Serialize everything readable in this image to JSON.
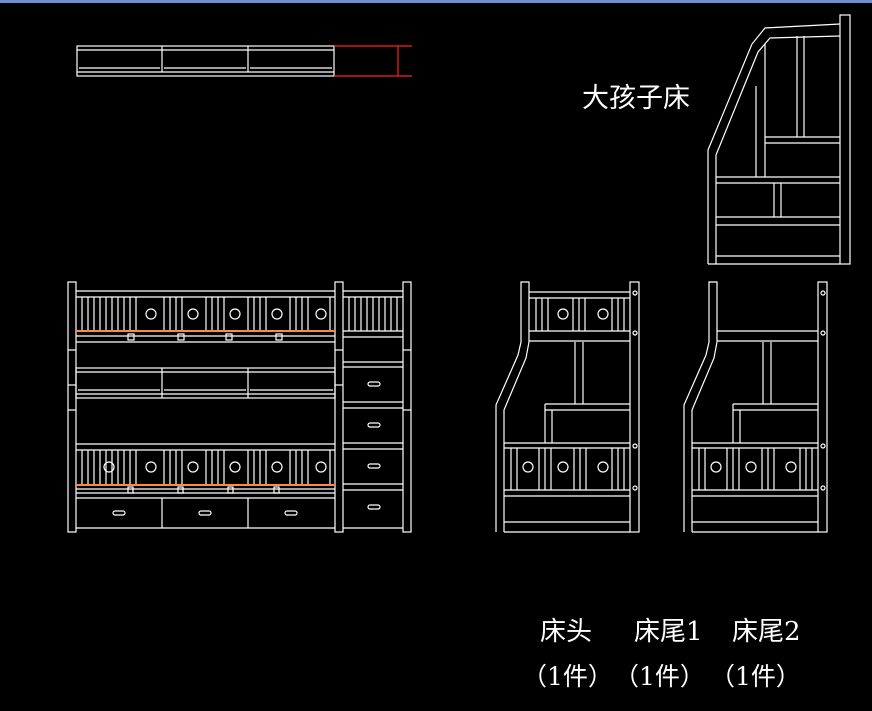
{
  "drawing": {
    "title": "大孩子床",
    "captions": {
      "head": "床头",
      "foot1": "床尾1",
      "foot2": "床尾2"
    },
    "quantities": {
      "head": "（1件）",
      "foot1": "（1件）",
      "foot2": "（1件）"
    }
  },
  "colors": {
    "background": "#000000",
    "line": "#ffffff",
    "accent_red": "#ff2020",
    "accent_orange": "#ff8a3d",
    "titlebar": "#6d8fd6"
  }
}
